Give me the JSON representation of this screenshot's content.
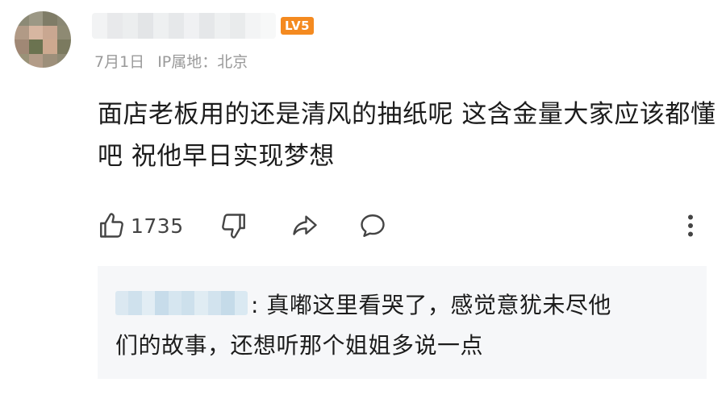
{
  "comment": {
    "level_badge": "LV5",
    "date": "7月1日",
    "ip_location": "IP属地：北京",
    "text": "面店老板用的还是清风的抽纸呢 这含金量大家应该都懂吧 祝他早日实现梦想",
    "actions": {
      "like_icon": "thumbs-up-icon",
      "like_count": "1735",
      "dislike_icon": "thumbs-down-icon",
      "share_icon": "share-arrow-icon",
      "reply_icon": "comment-bubble-icon",
      "more_icon": "more-vertical-icon"
    }
  },
  "reply": {
    "text_line1": ": 真嘟这里看哭了，感觉意犹未尽他",
    "text_line2": "们的故事，还想听那个姐姐多说一点"
  },
  "colors": {
    "level_badge": "#f48a20",
    "meta_text": "#9a9a9a",
    "reply_background": "#f6f7f9"
  }
}
